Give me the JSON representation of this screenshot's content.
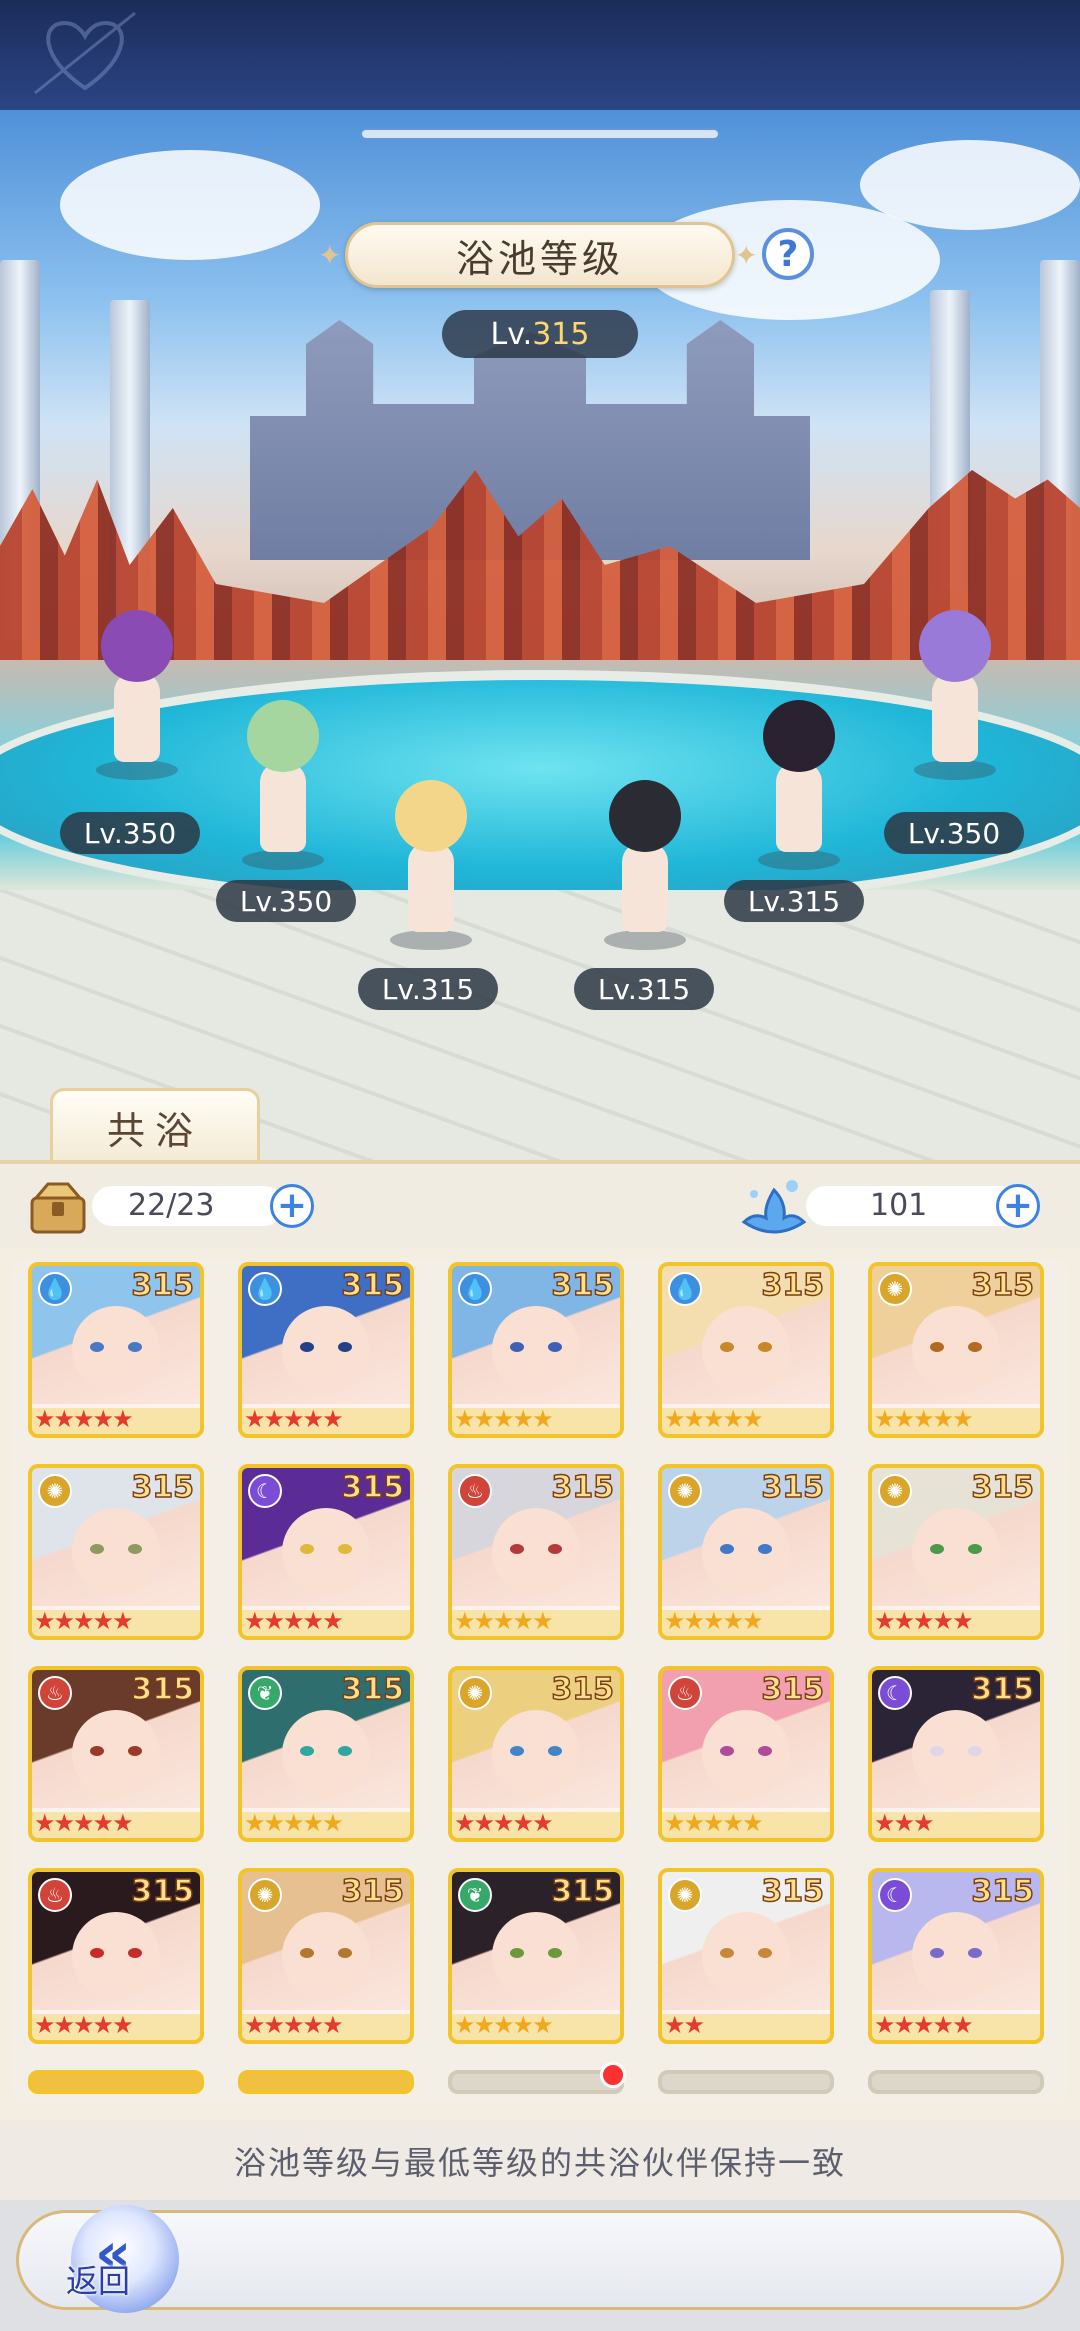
{
  "header": {
    "title": "浴池等级",
    "level_prefix": "Lv.",
    "level_value": "315"
  },
  "scene_characters": [
    {
      "name": "purple-cat-girl",
      "level": "Lv.350",
      "hair": "#8b4bb5"
    },
    {
      "name": "green-hair-girl",
      "level": "Lv.350",
      "hair": "#a6d6a0"
    },
    {
      "name": "blonde-girl",
      "level": "Lv.315",
      "hair": "#f3d68a"
    },
    {
      "name": "cow-girl",
      "level": "Lv.315",
      "hair": "#2b2b33"
    },
    {
      "name": "dark-anubis-girl",
      "level": "Lv.315",
      "hair": "#2a2230"
    },
    {
      "name": "lavender-twin-tail-girl",
      "level": "Lv.350",
      "hair": "#9a7ad8"
    }
  ],
  "tab": {
    "label": "共浴"
  },
  "resources": {
    "slots": {
      "icon": "treasure-box-icon",
      "value": "22/23"
    },
    "bath_points": {
      "icon": "water-splash-icon",
      "value": "101"
    }
  },
  "roster": [
    {
      "level": "315",
      "element": "water",
      "stars": [
        "red",
        "red",
        "red",
        "red",
        "red"
      ],
      "hair": "#8fc5ec",
      "eye": "#4a78c4"
    },
    {
      "level": "315",
      "element": "water",
      "stars": [
        "red",
        "red",
        "red",
        "red",
        "red"
      ],
      "hair": "#3f6fc4",
      "eye": "#23418a"
    },
    {
      "level": "315",
      "element": "water",
      "stars": [
        "gold",
        "gold",
        "gold",
        "gold",
        "gold"
      ],
      "hair": "#7fb6e6",
      "eye": "#3c62b8"
    },
    {
      "level": "315",
      "element": "water",
      "stars": [
        "gold",
        "gold",
        "gold",
        "gold",
        "gold"
      ],
      "hair": "#f4deb0",
      "eye": "#c7882a"
    },
    {
      "level": "315",
      "element": "light",
      "stars": [
        "gold",
        "gold",
        "gold",
        "gold",
        "gold"
      ],
      "hair": "#f0d09a",
      "eye": "#b26a22"
    },
    {
      "level": "315",
      "element": "light",
      "stars": [
        "red",
        "red",
        "red",
        "red",
        "red"
      ],
      "hair": "#dfe4ea",
      "eye": "#8f9a60"
    },
    {
      "level": "315",
      "element": "dark",
      "stars": [
        "red",
        "red",
        "red",
        "red",
        "red"
      ],
      "hair": "#5b2b96",
      "eye": "#e0b83a"
    },
    {
      "level": "315",
      "element": "fire",
      "stars": [
        "gold",
        "gold",
        "gold",
        "gold",
        "gold"
      ],
      "hair": "#d6d6dc",
      "eye": "#b23b3b"
    },
    {
      "level": "315",
      "element": "light",
      "stars": [
        "gold",
        "gold",
        "gold",
        "gold",
        "gold"
      ],
      "hair": "#bcd3ea",
      "eye": "#3e7ac6"
    },
    {
      "level": "315",
      "element": "light",
      "stars": [
        "red",
        "red",
        "red",
        "red",
        "red"
      ],
      "hair": "#e6e2d6",
      "eye": "#4a9a48"
    },
    {
      "level": "315",
      "element": "fire",
      "stars": [
        "red",
        "red",
        "red",
        "red",
        "red"
      ],
      "hair": "#6a3a2a",
      "eye": "#9a3a2a"
    },
    {
      "level": "315",
      "element": "wind",
      "stars": [
        "gold",
        "gold",
        "gold",
        "gold",
        "gold"
      ],
      "hair": "#2e6e6e",
      "eye": "#2fa6a0"
    },
    {
      "level": "315",
      "element": "light",
      "stars": [
        "red",
        "red",
        "red",
        "red",
        "red"
      ],
      "hair": "#ecd080",
      "eye": "#3f86c8"
    },
    {
      "level": "315",
      "element": "fire",
      "stars": [
        "gold",
        "gold",
        "gold",
        "gold",
        "gold"
      ],
      "hair": "#f2a0b0",
      "eye": "#b04a9a"
    },
    {
      "level": "315",
      "element": "dark",
      "stars": [
        "red",
        "red",
        "red"
      ],
      "hair": "#2a2436",
      "eye": "#ded6e6"
    },
    {
      "level": "315",
      "element": "fire",
      "stars": [
        "red",
        "red",
        "red",
        "red",
        "red"
      ],
      "hair": "#2a1a1e",
      "eye": "#c82a2a"
    },
    {
      "level": "315",
      "element": "light",
      "stars": [
        "red",
        "red",
        "red",
        "red",
        "red"
      ],
      "hair": "#e6c090",
      "eye": "#b27830"
    },
    {
      "level": "315",
      "element": "wind",
      "stars": [
        "gold",
        "gold",
        "gold",
        "gold",
        "gold"
      ],
      "hair": "#2a2228",
      "eye": "#6a9a3a"
    },
    {
      "level": "315",
      "element": "light",
      "stars": [
        "red",
        "red"
      ],
      "hair": "#efefef",
      "eye": "#c8883a"
    },
    {
      "level": "315",
      "element": "dark",
      "stars": [
        "red",
        "red",
        "red",
        "red",
        "red"
      ],
      "hair": "#b8b8ee",
      "eye": "#7a6ac8"
    }
  ],
  "footer": {
    "hint": "浴池等级与最低等级的共浴伙伴保持一致",
    "back_label": "返回"
  },
  "colors": {
    "accent_blue": "#3c82e6",
    "gold_frame": "#f2c42a",
    "star_red": "#e53b2d",
    "star_gold": "#f2a81c"
  }
}
